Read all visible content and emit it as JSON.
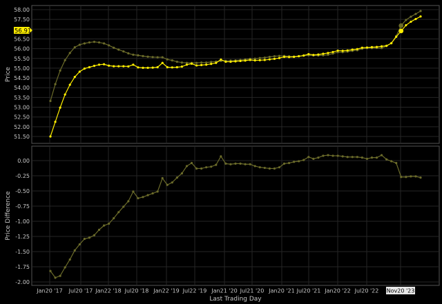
{
  "chart_data": [
    {
      "type": "line",
      "ylabel": "Price",
      "ylim": [
        51.25,
        58.0
      ],
      "yticks": [
        "51.50",
        "52.00",
        "52.50",
        "53.00",
        "53.50",
        "54.00",
        "54.50",
        "55.00",
        "55.50",
        "56.00",
        "56.50",
        "57.00",
        "57.50",
        "58.00"
      ],
      "current_value_label": "56.91",
      "grid": true,
      "series": [
        {
          "color": "#ffee00",
          "values": [
            51.5,
            52.25,
            52.98,
            53.65,
            54.15,
            54.55,
            54.82,
            54.98,
            55.05,
            55.12,
            55.18,
            55.2,
            55.13,
            55.1,
            55.1,
            55.1,
            55.09,
            55.18,
            55.04,
            55.02,
            55.02,
            55.03,
            55.05,
            55.27,
            55.05,
            55.04,
            55.05,
            55.08,
            55.18,
            55.23,
            55.14,
            55.16,
            55.18,
            55.22,
            55.27,
            55.44,
            55.33,
            55.33,
            55.35,
            55.37,
            55.39,
            55.42,
            55.4,
            55.41,
            55.42,
            55.45,
            55.48,
            55.52,
            55.58,
            55.57,
            55.58,
            55.61,
            55.65,
            55.72,
            55.68,
            55.7,
            55.74,
            55.78,
            55.83,
            55.9,
            55.89,
            55.91,
            55.95,
            55.98,
            56.05,
            56.06,
            56.08,
            56.09,
            56.12,
            56.15,
            56.28,
            56.61,
            56.91,
            57.2,
            57.38,
            57.52,
            57.65
          ]
        },
        {
          "color": "#6b6b2a",
          "values": [
            53.32,
            54.18,
            54.88,
            55.41,
            55.78,
            56.07,
            56.2,
            56.27,
            56.32,
            56.35,
            56.32,
            56.27,
            56.17,
            56.05,
            55.95,
            55.86,
            55.76,
            55.69,
            55.66,
            55.62,
            55.59,
            55.57,
            55.56,
            55.56,
            55.45,
            55.4,
            55.33,
            55.29,
            55.27,
            55.27,
            55.27,
            55.29,
            55.29,
            55.32,
            55.34,
            55.37,
            55.38,
            55.39,
            55.4,
            55.42,
            55.45,
            55.48,
            55.49,
            55.52,
            55.54,
            55.58,
            55.61,
            55.63,
            55.63,
            55.61,
            55.6,
            55.62,
            55.64,
            55.66,
            55.65,
            55.65,
            55.66,
            55.69,
            55.75,
            55.82,
            55.82,
            55.85,
            55.89,
            55.92,
            56.0,
            56.03,
            56.03,
            56.04,
            56.03,
            56.13,
            56.29,
            56.65,
            57.18,
            57.47,
            57.64,
            57.78,
            57.93
          ]
        }
      ]
    },
    {
      "type": "line",
      "xlabel": "Last Trading Day",
      "ylabel": "Price Difference",
      "ylim": [
        -2.05,
        0.15
      ],
      "yticks": [
        "0.00",
        "-0.25",
        "-0.50",
        "-0.75",
        "-1.00",
        "-1.25",
        "-1.50",
        "-1.75",
        "-2.00"
      ],
      "xticks": [
        "Jan20 '17",
        "Jul20 '17",
        "Jan22 '18",
        "Jul20 '18",
        "Jan22 '19",
        "Jul22 '19",
        "Jan21 '20",
        "Jul21 '20",
        "Jan20 '21",
        "Jul20 '21",
        "Jan20 '22",
        "Jul20 '22",
        "Nov20 '23"
      ],
      "highlighted_xtick": "Nov20 '23",
      "grid": true,
      "series": [
        {
          "color": "#6b6b2a",
          "values": [
            -1.82,
            -1.93,
            -1.9,
            -1.76,
            -1.63,
            -1.48,
            -1.38,
            -1.29,
            -1.27,
            -1.23,
            -1.14,
            -1.07,
            -1.04,
            -0.95,
            -0.85,
            -0.76,
            -0.67,
            -0.51,
            -0.62,
            -0.6,
            -0.57,
            -0.54,
            -0.51,
            -0.29,
            -0.4,
            -0.36,
            -0.28,
            -0.21,
            -0.09,
            -0.04,
            -0.13,
            -0.13,
            -0.11,
            -0.1,
            -0.07,
            0.07,
            -0.05,
            -0.06,
            -0.05,
            -0.05,
            -0.06,
            -0.06,
            -0.09,
            -0.11,
            -0.12,
            -0.13,
            -0.13,
            -0.11,
            -0.05,
            -0.04,
            -0.02,
            -0.01,
            0.01,
            0.06,
            0.03,
            0.05,
            0.08,
            0.09,
            0.08,
            0.08,
            0.07,
            0.06,
            0.06,
            0.06,
            0.05,
            0.03,
            0.05,
            0.05,
            0.09,
            0.02,
            -0.01,
            -0.04,
            -0.27,
            -0.27,
            -0.26,
            -0.26,
            -0.28
          ]
        }
      ]
    }
  ]
}
